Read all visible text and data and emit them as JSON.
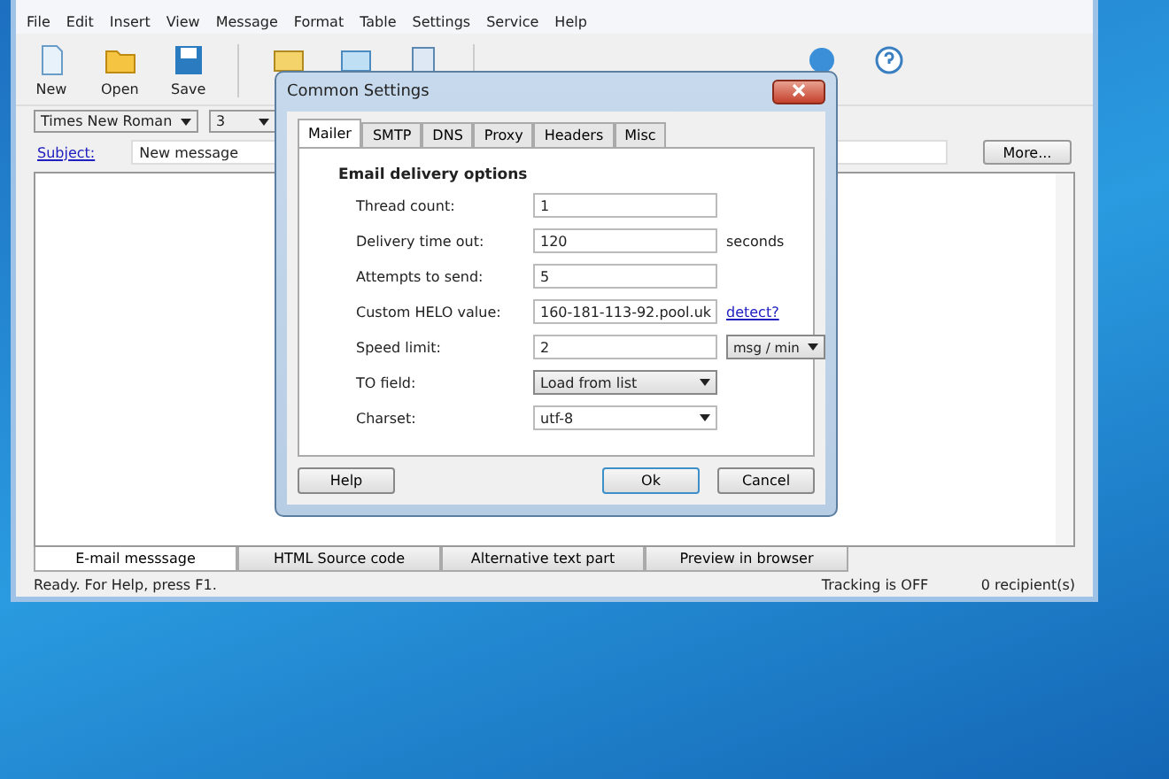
{
  "menu": [
    "File",
    "Edit",
    "Insert",
    "View",
    "Message",
    "Format",
    "Table",
    "Settings",
    "Service",
    "Help"
  ],
  "toolbar": [
    {
      "label": "New",
      "kind": "new"
    },
    {
      "label": "Open",
      "kind": "open"
    },
    {
      "label": "Save",
      "kind": "save"
    }
  ],
  "format_bar": {
    "font": "Times New Roman",
    "size": "3"
  },
  "subject": {
    "label": "Subject:",
    "value": "New message"
  },
  "more_button": "More...",
  "editor_tabs": [
    {
      "label": "E-mail messsage",
      "selected": true
    },
    {
      "label": "HTML Source code",
      "selected": false
    },
    {
      "label": "Alternative text part",
      "selected": false
    },
    {
      "label": "Preview in browser",
      "selected": false
    }
  ],
  "status_bar": {
    "message": "Ready. For Help, press F1.",
    "tracking": "Tracking is OFF",
    "recipients": "0 recipient(s)"
  },
  "dialog": {
    "title": "Common Settings",
    "tabs": [
      {
        "label": "Mailer",
        "selected": true
      },
      {
        "label": "SMTP",
        "selected": false
      },
      {
        "label": "DNS",
        "selected": false
      },
      {
        "label": "Proxy",
        "selected": false
      },
      {
        "label": "Headers",
        "selected": false
      },
      {
        "label": "Misc",
        "selected": false
      }
    ],
    "section_title": "Email delivery options",
    "fields": [
      {
        "label": "Thread count:",
        "value": "1",
        "kind": "text"
      },
      {
        "label": "Delivery time out:",
        "value": "120",
        "kind": "text",
        "suffix": "seconds"
      },
      {
        "label": "Attempts to send:",
        "value": "5",
        "kind": "text"
      },
      {
        "label": "Custom HELO value:",
        "value": "160-181-113-92.pool.uk",
        "kind": "text",
        "link": "detect?"
      },
      {
        "label": "Speed limit:",
        "value": "2",
        "kind": "text",
        "unit": "msg / min"
      },
      {
        "label": "TO field:",
        "value": "Load from list",
        "kind": "dropdown"
      },
      {
        "label": "Charset:",
        "value": "utf-8",
        "kind": "combo"
      }
    ],
    "buttons": [
      {
        "label": "Help",
        "kind": "help"
      },
      {
        "label": "Ok",
        "kind": "ok"
      },
      {
        "label": "Cancel",
        "kind": "cancel"
      }
    ]
  }
}
